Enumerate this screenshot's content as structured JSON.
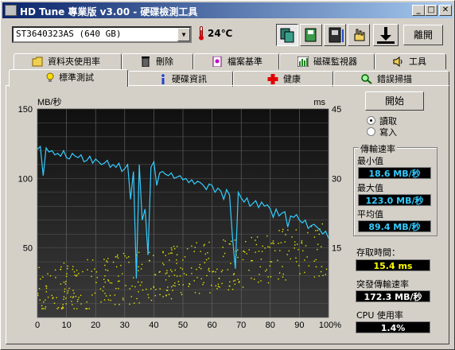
{
  "window": {
    "title": "HD Tune 專業版 v3.00 - 硬碟檢測工具",
    "minimize": "_",
    "maximize": "□",
    "close": "✕"
  },
  "toolbar": {
    "drive": "ST3640323AS  (640 GB)",
    "temperature": "24",
    "temperature_unit": "℃",
    "exit_label": "離開",
    "icons": [
      "copy-icon",
      "save-icon",
      "disk-icon",
      "options-icon",
      "download-icon"
    ]
  },
  "tabs_top": [
    {
      "label": "資料夾使用率",
      "icon": "folder-icon"
    },
    {
      "label": "刪除",
      "icon": "trash-icon"
    },
    {
      "label": "檔案基準",
      "icon": "file-benchmark-icon"
    },
    {
      "label": "磁碟監視器",
      "icon": "monitor-icon"
    },
    {
      "label": "工具",
      "icon": "speaker-icon"
    }
  ],
  "tabs_bottom": [
    {
      "label": "標準測試",
      "icon": "bulb-icon",
      "active": true
    },
    {
      "label": "硬碟資訊",
      "icon": "info-icon",
      "active": false
    },
    {
      "label": "健康",
      "icon": "health-cross-icon",
      "active": false
    },
    {
      "label": "錯誤掃描",
      "icon": "magnifier-icon",
      "active": false
    }
  ],
  "controls": {
    "start_label": "開始",
    "read_label": "讀取",
    "write_label": "寫入",
    "selected_mode": "read"
  },
  "stats": {
    "transfer_group": "傳輸速率",
    "min_label": "最小值",
    "min_value": "18.6 MB/秒",
    "max_label": "最大值",
    "max_value": "123.0 MB/秒",
    "avg_label": "平均值",
    "avg_value": "89.4 MB/秒",
    "access_label": "存取時間：",
    "access_value": "15.4 ms",
    "burst_label": "突發傳輸速率",
    "burst_value": "172.3 MB/秒",
    "cpu_label": "CPU 使用率",
    "cpu_value": "1.4%"
  },
  "chart_data": {
    "type": "line",
    "ylabel": "MB/秒",
    "y2label": "ms",
    "xlim": [
      0,
      100
    ],
    "ylim": [
      0,
      150
    ],
    "y2lim": [
      0,
      45
    ],
    "x_ticks": [
      "0",
      "10",
      "20",
      "30",
      "40",
      "50",
      "60",
      "70",
      "80",
      "90",
      "100%"
    ],
    "y_ticks": [
      "50",
      "100",
      "150"
    ],
    "y2_ticks": [
      "15",
      "30",
      "45"
    ],
    "grid": true,
    "series": [
      {
        "color": "#33ccff",
        "x": [
          0,
          1,
          2,
          3,
          4,
          5,
          6,
          7,
          8,
          9,
          10,
          11,
          12,
          13,
          14,
          15,
          16,
          17,
          18,
          19,
          20,
          21,
          22,
          23,
          24,
          25,
          26,
          27,
          28,
          29,
          30,
          31,
          32,
          33,
          34,
          35,
          36,
          37,
          38,
          39,
          40,
          41,
          42,
          43,
          44,
          45,
          46,
          47,
          48,
          49,
          50,
          51,
          52,
          53,
          54,
          55,
          56,
          57,
          58,
          59,
          60,
          61,
          62,
          63,
          64,
          65,
          66,
          67,
          68,
          69,
          70,
          71,
          72,
          73,
          74,
          75,
          76,
          77,
          78,
          79,
          80,
          81,
          82,
          83,
          84,
          85,
          86,
          87,
          88,
          89,
          90,
          91,
          92,
          93,
          94,
          95,
          96,
          97,
          98,
          99,
          100
        ],
        "values": [
          121,
          123,
          102,
          122,
          119,
          120,
          117,
          118,
          116,
          120,
          115,
          114,
          118,
          116,
          115,
          117,
          112,
          113,
          116,
          111,
          114,
          112,
          110,
          111,
          113,
          108,
          110,
          108,
          111,
          105,
          107,
          110,
          85,
          105,
          28,
          110,
          70,
          78,
          45,
          108,
          112,
          95,
          104,
          105,
          103,
          102,
          104,
          100,
          101,
          102,
          99,
          100,
          97,
          99,
          96,
          98,
          97,
          95,
          92,
          96,
          95,
          90,
          93,
          91,
          85,
          92,
          88,
          58,
          35,
          90,
          86,
          83,
          86,
          80,
          82,
          84,
          79,
          83,
          80,
          81,
          78,
          72,
          78,
          73,
          75,
          76,
          65,
          73,
          72,
          74,
          70,
          68,
          70,
          64,
          66,
          67,
          65,
          63,
          60,
          62,
          57
        ]
      }
    ]
  }
}
